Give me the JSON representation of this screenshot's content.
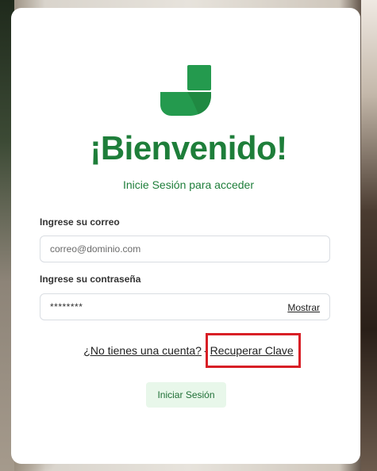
{
  "login": {
    "title": "¡Bienvenido!",
    "subtitle": "Inicie Sesión para acceder",
    "email_label": "Ingrese su correo",
    "email_placeholder": "correo@dominio.com",
    "password_label": "Ingrese su contraseña",
    "password_masked": "********",
    "show_password": "Mostrar",
    "no_account_link": "¿No tienes una cuenta?",
    "separator": "-",
    "recover_link": "Recuperar Clave",
    "submit_button": "Iniciar Sesión"
  },
  "colors": {
    "brand_green": "#1e7e3a",
    "button_bg": "#e8f7ea",
    "highlight_red": "#d81f26"
  },
  "icons": {
    "logo": "j-logo"
  }
}
